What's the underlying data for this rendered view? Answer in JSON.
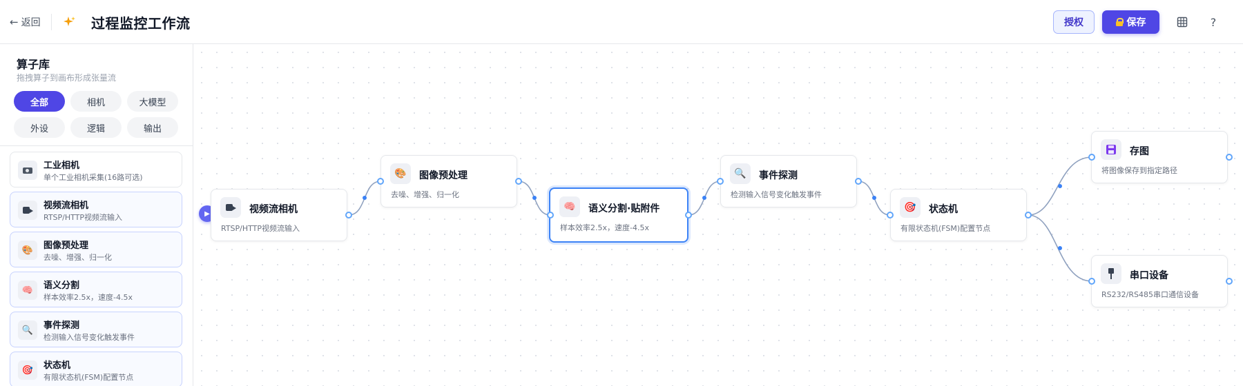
{
  "header": {
    "back_label": "返回",
    "title": "过程监控工作流",
    "auth_label": "授权",
    "save_label": "保存",
    "help_label": "?"
  },
  "sidebar": {
    "title": "算子库",
    "subtitle": "拖拽算子到画布形成张量流",
    "chips": [
      "全部",
      "相机",
      "大模型",
      "外设",
      "逻辑",
      "输出"
    ],
    "active_chip": "全部",
    "items": [
      {
        "icon": "industrial-camera-icon",
        "name": "工业相机",
        "desc": "单个工业相机采集(16路可选)"
      },
      {
        "icon": "video-camera-icon",
        "name": "视频流相机",
        "desc": "RTSP/HTTP视频流输入"
      },
      {
        "icon": "palette-icon",
        "name": "图像预处理",
        "desc": "去噪、增强、归一化"
      },
      {
        "icon": "brain-icon",
        "name": "语义分割",
        "desc": "样本效率2.5x，速度-4.5x"
      },
      {
        "icon": "magnifier-icon",
        "name": "事件探测",
        "desc": "检测输入信号变化触发事件"
      },
      {
        "icon": "target-icon",
        "name": "状态机",
        "desc": "有限状态机(FSM)配置节点"
      }
    ]
  },
  "canvas": {
    "nodes": [
      {
        "id": "video",
        "icon": "video-camera-icon",
        "title": "视频流相机",
        "desc": "RTSP/HTTP视频流输入"
      },
      {
        "id": "pre",
        "icon": "palette-icon",
        "title": "图像预处理",
        "desc": "去噪、增强、归一化"
      },
      {
        "id": "seg",
        "icon": "brain-icon",
        "title": "语义分割·贴附件",
        "desc": "样本效率2.5x，速度-4.5x"
      },
      {
        "id": "event",
        "icon": "magnifier-icon",
        "title": "事件探测",
        "desc": "检测输入信号变化触发事件"
      },
      {
        "id": "fsm",
        "icon": "target-icon",
        "title": "状态机",
        "desc": "有限状态机(FSM)配置节点"
      },
      {
        "id": "save",
        "icon": "floppy-disk-icon",
        "title": "存图",
        "desc": "将图像保存到指定路径"
      },
      {
        "id": "serial",
        "icon": "plug-icon",
        "title": "串口设备",
        "desc": "RS232/RS485串口通信设备"
      }
    ],
    "selected_node": "seg"
  },
  "colors": {
    "accent": "#4f46e5",
    "edge": "#8fa1bf",
    "port": "#60a5fa",
    "selected_border": "#3b82f6"
  }
}
